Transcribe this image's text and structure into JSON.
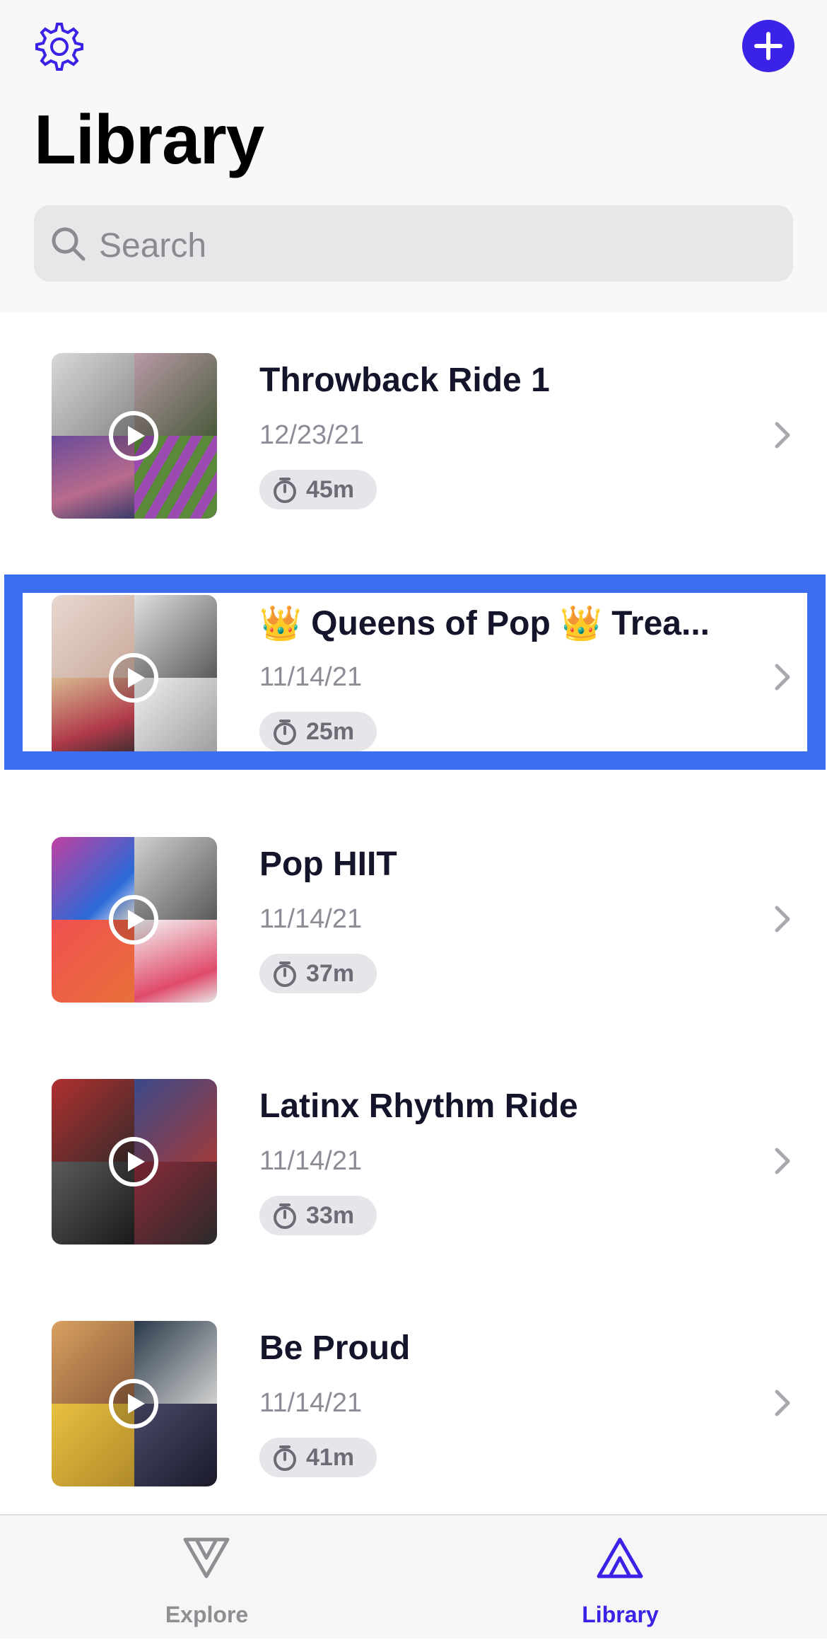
{
  "header": {
    "title": "Library",
    "settings_icon": "gear-icon",
    "add_icon": "plus-icon"
  },
  "search": {
    "placeholder": "Search"
  },
  "colors": {
    "accent": "#3a22e6",
    "highlight": "#3c6ff0",
    "inactive": "#8e8e93"
  },
  "playlists": [
    {
      "title": "Throwback Ride 1",
      "date": "12/23/21",
      "duration": "45m"
    },
    {
      "title": "👑 Queens of Pop 👑 Trea...",
      "date": "11/14/21",
      "duration": "25m"
    },
    {
      "title": "Pop HIIT",
      "date": "11/14/21",
      "duration": "37m"
    },
    {
      "title": "Latinx Rhythm Ride",
      "date": "11/14/21",
      "duration": "33m"
    },
    {
      "title": "Be Proud",
      "date": "11/14/21",
      "duration": "41m"
    }
  ],
  "tabbar": {
    "tabs": [
      {
        "label": "Explore",
        "icon": "explore-triangle-icon",
        "active": false
      },
      {
        "label": "Library",
        "icon": "library-triangle-icon",
        "active": true
      }
    ]
  }
}
